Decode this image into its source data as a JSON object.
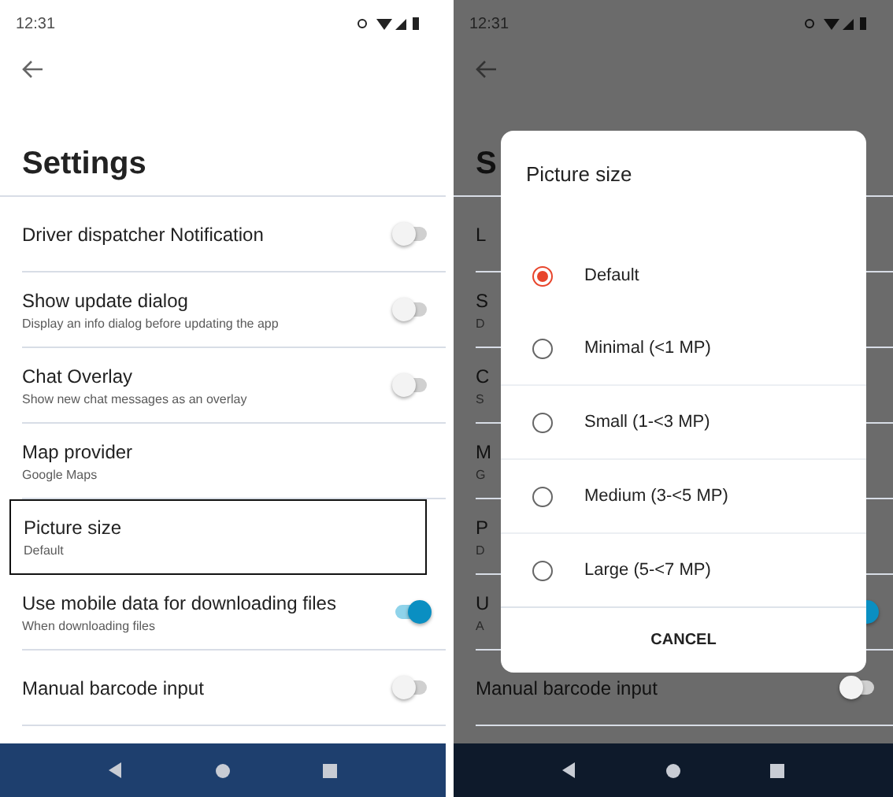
{
  "screens": [
    {
      "kind": "plain",
      "status_time": "12:31",
      "title": "Settings",
      "items": [
        {
          "label": "Driver dispatcher Notification",
          "kind": "toggle",
          "on": false,
          "highlighted": false
        },
        {
          "label": "Show update dialog",
          "subtitle": "Display an info dialog before updating the app",
          "kind": "toggle",
          "on": false,
          "highlighted": false
        },
        {
          "label": "Chat Overlay",
          "subtitle": "Show new chat messages as an overlay",
          "kind": "toggle",
          "on": false,
          "highlighted": false
        },
        {
          "label": "Map provider",
          "subtitle": "Google Maps",
          "kind": "text",
          "highlighted": false
        },
        {
          "label": "Picture size",
          "subtitle": "Default",
          "kind": "text",
          "highlighted": true
        },
        {
          "label": "Use mobile data for downloading files",
          "subtitle": "When downloading files",
          "kind": "toggle",
          "on": true,
          "highlighted": false
        },
        {
          "label": "Manual barcode input",
          "kind": "toggle",
          "on": false,
          "highlighted": false
        }
      ]
    },
    {
      "kind": "dimmed",
      "status_time": "12:31",
      "title": "S",
      "items": [
        {
          "label": "L",
          "kind": "text",
          "highlighted": false
        },
        {
          "label": "S",
          "subtitle": "D",
          "kind": "text",
          "highlighted": false
        },
        {
          "label": "C",
          "subtitle": "S",
          "kind": "text",
          "highlighted": false
        },
        {
          "label": "M",
          "subtitle": "G",
          "kind": "text",
          "highlighted": false
        },
        {
          "label": "P",
          "subtitle": "D",
          "kind": "text",
          "highlighted": false
        },
        {
          "label": "U",
          "subtitle": "A",
          "kind": "toggle",
          "on": true,
          "highlighted": false
        },
        {
          "label": "Manual barcode input",
          "kind": "toggle",
          "on": false,
          "highlighted": false
        }
      ],
      "dialog": {
        "title": "Picture size",
        "options": [
          {
            "label": "Default",
            "selected": true
          },
          {
            "label": "Minimal (<1 MP)",
            "selected": false
          },
          {
            "label": "Small (1-<3 MP)",
            "selected": false
          },
          {
            "label": "Medium (3-<5 MP)",
            "selected": false
          },
          {
            "label": "Large (5-<7 MP)",
            "selected": false
          }
        ],
        "cancel": "CANCEL"
      }
    }
  ]
}
